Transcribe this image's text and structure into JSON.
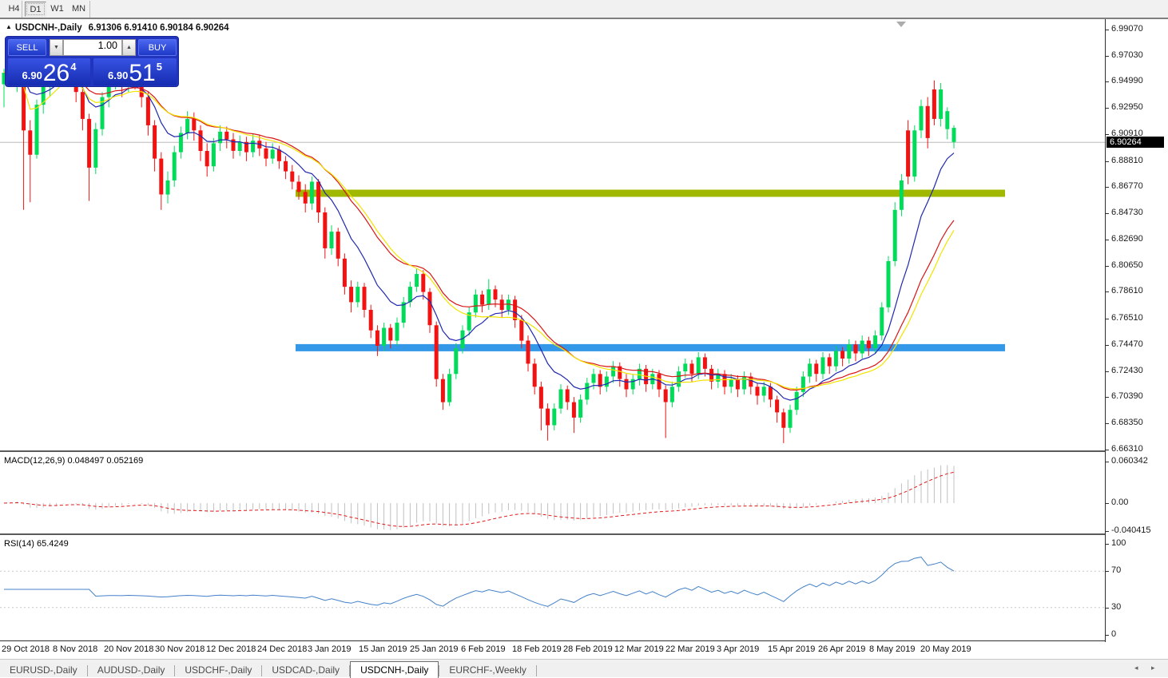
{
  "toolbar": {
    "timeframes": [
      {
        "label": "H4",
        "active": false
      },
      {
        "label": "D1",
        "active": true
      },
      {
        "label": "W1",
        "active": false
      },
      {
        "label": "MN",
        "active": false
      }
    ]
  },
  "chart_header": {
    "symbol_title": "USDCNH-,Daily",
    "ohlc": "6.91306 6.91410 6.90184 6.90264"
  },
  "trade_panel": {
    "sell_label": "SELL",
    "buy_label": "BUY",
    "volume": "1.00",
    "sell_price_small": "6.90",
    "sell_price_big": "26",
    "sell_price_sup": "4",
    "buy_price_small": "6.90",
    "buy_price_big": "51",
    "buy_price_sup": "5"
  },
  "price_axis": {
    "labels": [
      "6.99070",
      "6.97030",
      "6.94990",
      "6.92950",
      "6.90910",
      "6.88810",
      "6.86770",
      "6.84730",
      "6.82690",
      "6.80650",
      "6.78610",
      "6.76510",
      "6.74470",
      "6.72430",
      "6.70390",
      "6.68350",
      "6.66310"
    ],
    "current": "6.90264"
  },
  "macd": {
    "label": "MACD(12,26,9) 0.048497 0.052169",
    "axis": [
      "0.060342",
      "0.00",
      "-0.040415"
    ]
  },
  "rsi": {
    "label": "RSI(14) 65.4249",
    "axis": [
      "100",
      "70",
      "30",
      "0"
    ]
  },
  "time_axis": {
    "labels": [
      "29 Oct 2018",
      "8 Nov 2018",
      "20 Nov 2018",
      "30 Nov 2018",
      "12 Dec 2018",
      "24 Dec 2018",
      "3 Jan 2019",
      "15 Jan 2019",
      "25 Jan 2019",
      "6 Feb 2019",
      "18 Feb 2019",
      "28 Feb 2019",
      "12 Mar 2019",
      "22 Mar 2019",
      "3 Apr 2019",
      "15 Apr 2019",
      "26 Apr 2019",
      "8 May 2019",
      "20 May 2019"
    ]
  },
  "tabs": {
    "items": [
      {
        "label": "EURUSD-,Daily",
        "active": false
      },
      {
        "label": "AUDUSD-,Daily",
        "active": false
      },
      {
        "label": "USDCHF-,Daily",
        "active": false
      },
      {
        "label": "USDCAD-,Daily",
        "active": false
      },
      {
        "label": "USDCNH-,Daily",
        "active": true
      },
      {
        "label": "EURCHF-,Weekly",
        "active": false
      }
    ],
    "scroll_left": "◂",
    "scroll_right": "▸"
  },
  "colors": {
    "up": "#00DC5A",
    "down": "#F21212",
    "ema_fast": "#1F28AE",
    "ema_mid": "#D81616",
    "ema_slow": "#F2E400",
    "resistance": "#A0B800",
    "support": "#3498E8",
    "macd_bar": "#C0C0C0",
    "macd_signal": "#E01818",
    "rsi_line": "#4380C8",
    "price_line": "#BCBCBC",
    "current_tag_bg": "#000000"
  },
  "chart_data": {
    "type": "candlestick",
    "symbol": "USDCNH-",
    "timeframe": "Daily",
    "title": "USDCNH-,Daily",
    "ohlc_display": {
      "open": 6.91306,
      "high": 6.9141,
      "low": 6.90184,
      "close": 6.90264
    },
    "current_price": 6.90264,
    "ylim": [
      6.6631,
      6.9907
    ],
    "grid": "off",
    "hlines": [
      {
        "name": "resistance-line",
        "value": 6.863,
        "color": "resistance"
      },
      {
        "name": "support-line",
        "value": 6.7425,
        "color": "support"
      }
    ],
    "moving_averages": [
      {
        "method": "EMA",
        "period": 10,
        "color": "ema_fast"
      },
      {
        "method": "EMA",
        "period": 22,
        "color": "ema_mid"
      },
      {
        "method": "LWMA",
        "period": 30,
        "color": "ema_slow"
      }
    ],
    "indicators": [
      {
        "name": "MACD",
        "params": "12,26,9",
        "values": [
          0.048497,
          0.052169
        ],
        "axis_ticks": [
          "0.060342",
          "0.00",
          "-0.040415"
        ],
        "ylim": [
          -0.040415,
          0.060342
        ]
      },
      {
        "name": "RSI",
        "params": "14",
        "value": 65.4249,
        "axis_ticks": [
          "100",
          "70",
          "30",
          "0"
        ],
        "levels": [
          70,
          30
        ],
        "ylim": [
          0,
          100
        ]
      }
    ],
    "candles": [
      [
        6.948,
        6.96,
        6.93,
        6.957
      ],
      [
        6.957,
        6.972,
        6.952,
        6.968
      ],
      [
        6.968,
        6.977,
        6.942,
        6.974
      ],
      [
        6.974,
        6.976,
        6.85,
        6.912
      ],
      [
        6.912,
        6.92,
        6.856,
        6.893
      ],
      [
        6.893,
        6.936,
        6.89,
        6.932
      ],
      [
        6.932,
        6.95,
        6.925,
        6.947
      ],
      [
        6.947,
        6.958,
        6.938,
        6.955
      ],
      [
        6.955,
        6.968,
        6.946,
        6.963
      ],
      [
        6.963,
        6.977,
        6.956,
        6.972
      ],
      [
        6.972,
        6.975,
        6.95,
        6.958
      ],
      [
        6.958,
        6.964,
        6.934,
        6.942
      ],
      [
        6.942,
        6.948,
        6.912,
        6.921
      ],
      [
        6.921,
        6.925,
        6.857,
        6.883
      ],
      [
        6.883,
        6.918,
        6.878,
        6.913
      ],
      [
        6.913,
        6.942,
        6.908,
        6.938
      ],
      [
        6.938,
        6.956,
        6.93,
        6.953
      ],
      [
        6.953,
        6.964,
        6.944,
        6.959
      ],
      [
        6.959,
        6.962,
        6.938,
        6.947
      ],
      [
        6.947,
        6.966,
        6.942,
        6.961
      ],
      [
        6.961,
        6.965,
        6.944,
        6.952
      ],
      [
        6.952,
        6.958,
        6.93,
        6.938
      ],
      [
        6.938,
        6.942,
        6.908,
        6.916
      ],
      [
        6.916,
        6.92,
        6.88,
        6.89
      ],
      [
        6.89,
        6.895,
        6.85,
        6.862
      ],
      [
        6.862,
        6.88,
        6.855,
        6.873
      ],
      [
        6.873,
        6.9,
        6.868,
        6.895
      ],
      [
        6.895,
        6.915,
        6.89,
        6.91
      ],
      [
        6.91,
        6.927,
        6.905,
        6.921
      ],
      [
        6.921,
        6.926,
        6.904,
        6.912
      ],
      [
        6.912,
        6.916,
        6.888,
        6.896
      ],
      [
        6.896,
        6.902,
        6.876,
        6.884
      ],
      [
        6.884,
        6.906,
        6.88,
        6.902
      ],
      [
        6.902,
        6.916,
        6.896,
        6.911
      ],
      [
        6.911,
        6.915,
        6.898,
        6.905
      ],
      [
        6.905,
        6.91,
        6.89,
        6.896
      ],
      [
        6.896,
        6.908,
        6.892,
        6.903
      ],
      [
        6.903,
        6.907,
        6.888,
        6.895
      ],
      [
        6.895,
        6.909,
        6.891,
        6.904
      ],
      [
        6.904,
        6.908,
        6.892,
        6.898
      ],
      [
        6.898,
        6.903,
        6.884,
        6.89
      ],
      [
        6.89,
        6.902,
        6.886,
        6.897
      ],
      [
        6.897,
        6.9,
        6.882,
        6.888
      ],
      [
        6.888,
        6.892,
        6.874,
        6.88
      ],
      [
        6.88,
        6.885,
        6.866,
        6.872
      ],
      [
        6.872,
        6.877,
        6.858,
        6.864
      ],
      [
        6.864,
        6.87,
        6.848,
        6.855
      ],
      [
        6.855,
        6.876,
        6.85,
        6.872
      ],
      [
        6.872,
        6.874,
        6.84,
        6.848
      ],
      [
        6.848,
        6.852,
        6.812,
        6.82
      ],
      [
        6.82,
        6.838,
        6.815,
        6.833
      ],
      [
        6.833,
        6.836,
        6.806,
        6.812
      ],
      [
        6.812,
        6.816,
        6.784,
        6.79
      ],
      [
        6.79,
        6.795,
        6.77,
        6.778
      ],
      [
        6.778,
        6.794,
        6.774,
        6.79
      ],
      [
        6.79,
        6.793,
        6.766,
        6.772
      ],
      [
        6.772,
        6.776,
        6.75,
        6.756
      ],
      [
        6.756,
        6.76,
        6.736,
        6.744
      ],
      [
        6.744,
        6.762,
        6.74,
        6.758
      ],
      [
        6.758,
        6.761,
        6.742,
        6.748
      ],
      [
        6.748,
        6.766,
        6.744,
        6.762
      ],
      [
        6.762,
        6.782,
        6.758,
        6.778
      ],
      [
        6.778,
        6.794,
        6.774,
        6.79
      ],
      [
        6.79,
        6.804,
        6.786,
        6.8
      ],
      [
        6.8,
        6.803,
        6.78,
        6.786
      ],
      [
        6.786,
        6.789,
        6.754,
        6.76
      ],
      [
        6.76,
        6.763,
        6.712,
        6.718
      ],
      [
        6.718,
        6.722,
        6.694,
        6.7
      ],
      [
        6.7,
        6.726,
        6.697,
        6.722
      ],
      [
        6.722,
        6.746,
        6.718,
        6.742
      ],
      [
        6.742,
        6.76,
        6.738,
        6.756
      ],
      [
        6.756,
        6.774,
        6.752,
        6.77
      ],
      [
        6.77,
        6.788,
        6.766,
        6.784
      ],
      [
        6.784,
        6.787,
        6.77,
        6.776
      ],
      [
        6.776,
        6.796,
        6.772,
        6.788
      ],
      [
        6.788,
        6.791,
        6.774,
        6.78
      ],
      [
        6.78,
        6.784,
        6.766,
        6.772
      ],
      [
        6.772,
        6.784,
        6.768,
        6.78
      ],
      [
        6.78,
        6.783,
        6.758,
        6.764
      ],
      [
        6.764,
        6.768,
        6.742,
        6.748
      ],
      [
        6.748,
        6.752,
        6.724,
        6.73
      ],
      [
        6.73,
        6.734,
        6.706,
        6.712
      ],
      [
        6.712,
        6.716,
        6.678,
        6.695
      ],
      [
        6.695,
        6.699,
        6.67,
        6.682
      ],
      [
        6.682,
        6.699,
        6.678,
        6.695
      ],
      [
        6.695,
        6.714,
        6.691,
        6.71
      ],
      [
        6.71,
        6.713,
        6.694,
        6.7
      ],
      [
        6.7,
        6.704,
        6.676,
        6.688
      ],
      [
        6.688,
        6.706,
        6.684,
        6.702
      ],
      [
        6.702,
        6.719,
        6.698,
        6.715
      ],
      [
        6.715,
        6.726,
        6.71,
        6.722
      ],
      [
        6.722,
        6.725,
        6.706,
        6.712
      ],
      [
        6.712,
        6.724,
        6.708,
        6.72
      ],
      [
        6.72,
        6.732,
        6.715,
        6.728
      ],
      [
        6.728,
        6.731,
        6.712,
        6.718
      ],
      [
        6.718,
        6.722,
        6.704,
        6.71
      ],
      [
        6.71,
        6.722,
        6.706,
        6.718
      ],
      [
        6.718,
        6.73,
        6.713,
        6.726
      ],
      [
        6.726,
        6.729,
        6.708,
        6.714
      ],
      [
        6.714,
        6.726,
        6.71,
        6.722
      ],
      [
        6.722,
        6.725,
        6.704,
        6.71
      ],
      [
        6.71,
        6.713,
        6.672,
        6.7
      ],
      [
        6.7,
        6.716,
        6.696,
        6.712
      ],
      [
        6.712,
        6.728,
        6.708,
        6.724
      ],
      [
        6.724,
        6.734,
        6.719,
        6.73
      ],
      [
        6.73,
        6.733,
        6.716,
        6.722
      ],
      [
        6.722,
        6.739,
        6.718,
        6.735
      ],
      [
        6.735,
        6.738,
        6.72,
        6.726
      ],
      [
        6.726,
        6.729,
        6.71,
        6.716
      ],
      [
        6.716,
        6.726,
        6.711,
        6.722
      ],
      [
        6.722,
        6.725,
        6.706,
        6.712
      ],
      [
        6.712,
        6.722,
        6.707,
        6.718
      ],
      [
        6.718,
        6.721,
        6.704,
        6.71
      ],
      [
        6.71,
        6.724,
        6.706,
        6.72
      ],
      [
        6.72,
        6.723,
        6.706,
        6.712
      ],
      [
        6.712,
        6.715,
        6.698,
        6.705
      ],
      [
        6.705,
        6.716,
        6.7,
        6.712
      ],
      [
        6.712,
        6.715,
        6.696,
        6.702
      ],
      [
        6.702,
        6.705,
        6.684,
        6.692
      ],
      [
        6.692,
        6.695,
        6.668,
        6.68
      ],
      [
        6.68,
        6.698,
        6.676,
        6.694
      ],
      [
        6.694,
        6.712,
        6.69,
        6.708
      ],
      [
        6.708,
        6.724,
        6.704,
        6.72
      ],
      [
        6.72,
        6.734,
        6.715,
        6.73
      ],
      [
        6.73,
        6.733,
        6.716,
        6.722
      ],
      [
        6.722,
        6.739,
        6.718,
        6.735
      ],
      [
        6.735,
        6.738,
        6.722,
        6.728
      ],
      [
        6.728,
        6.744,
        6.724,
        6.74
      ],
      [
        6.74,
        6.743,
        6.728,
        6.734
      ],
      [
        6.734,
        6.749,
        6.73,
        6.745
      ],
      [
        6.745,
        6.748,
        6.732,
        6.738
      ],
      [
        6.738,
        6.752,
        6.734,
        6.748
      ],
      [
        6.748,
        6.751,
        6.736,
        6.742
      ],
      [
        6.742,
        6.756,
        6.738,
        6.752
      ],
      [
        6.752,
        6.778,
        6.748,
        6.774
      ],
      [
        6.774,
        6.814,
        6.77,
        6.81
      ],
      [
        6.81,
        6.856,
        6.806,
        6.85
      ],
      [
        6.85,
        6.878,
        6.845,
        6.873
      ],
      [
        6.912,
        6.92,
        6.87,
        6.876
      ],
      [
        6.876,
        6.916,
        6.872,
        6.912
      ],
      [
        6.912,
        6.936,
        6.906,
        6.931
      ],
      [
        6.931,
        6.938,
        6.898,
        6.906
      ],
      [
        6.944,
        6.951,
        6.916,
        6.921
      ],
      [
        6.921,
        6.949,
        6.915,
        6.944
      ],
      [
        6.913,
        6.93,
        6.905,
        6.927
      ],
      [
        6.903,
        6.916,
        6.898,
        6.914
      ]
    ]
  }
}
